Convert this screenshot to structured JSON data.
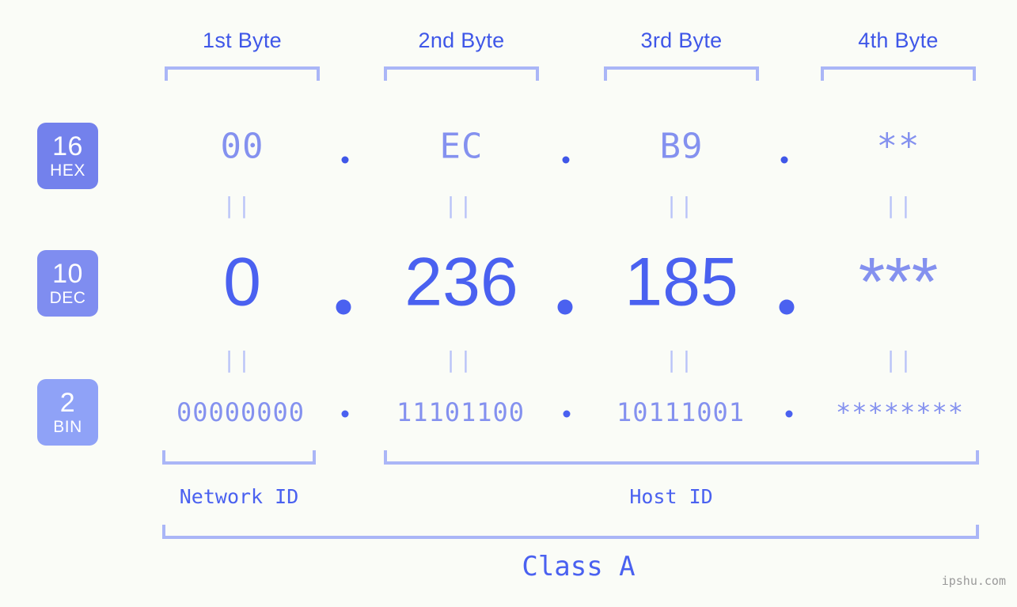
{
  "page": {
    "background_color": "#fafcf7",
    "accent_color": "#4a61f0",
    "muted_accent_color": "#8491ef",
    "bracket_color": "#aab6f7",
    "badge_color_hex": "#7381ec",
    "badge_color_dec": "#7f8df0",
    "badge_color_bin": "#8fa2f7",
    "watermark": "ipshu.com"
  },
  "byte_headers": [
    {
      "label": "1st Byte"
    },
    {
      "label": "2nd Byte"
    },
    {
      "label": "3rd Byte"
    },
    {
      "label": "4th Byte"
    }
  ],
  "bases": [
    {
      "number": "16",
      "name": "HEX"
    },
    {
      "number": "10",
      "name": "DEC"
    },
    {
      "number": "2",
      "name": "BIN"
    }
  ],
  "rows": {
    "hex": {
      "values": [
        "00",
        "EC",
        "B9",
        "**"
      ]
    },
    "dec": {
      "values": [
        "0",
        "236",
        "185",
        "***"
      ]
    },
    "bin": {
      "values": [
        "00000000",
        "11101100",
        "10111001",
        "********"
      ]
    }
  },
  "separator": ".",
  "equals_glyph": "||",
  "segments": {
    "network_id": "Network ID",
    "host_id": "Host ID",
    "class": "Class A"
  },
  "chart_data": {
    "type": "table",
    "title": "IP address byte breakdown",
    "columns": [
      "1st Byte",
      "2nd Byte",
      "3rd Byte",
      "4th Byte"
    ],
    "rows": [
      {
        "base": "16 HEX",
        "values": [
          "00",
          "EC",
          "B9",
          "**"
        ]
      },
      {
        "base": "10 DEC",
        "values": [
          "0",
          "236",
          "185",
          "***"
        ]
      },
      {
        "base": "2 BIN",
        "values": [
          "00000000",
          "11101100",
          "10111001",
          "********"
        ]
      }
    ],
    "annotations": [
      "Network ID",
      "Host ID",
      "Class A"
    ]
  }
}
